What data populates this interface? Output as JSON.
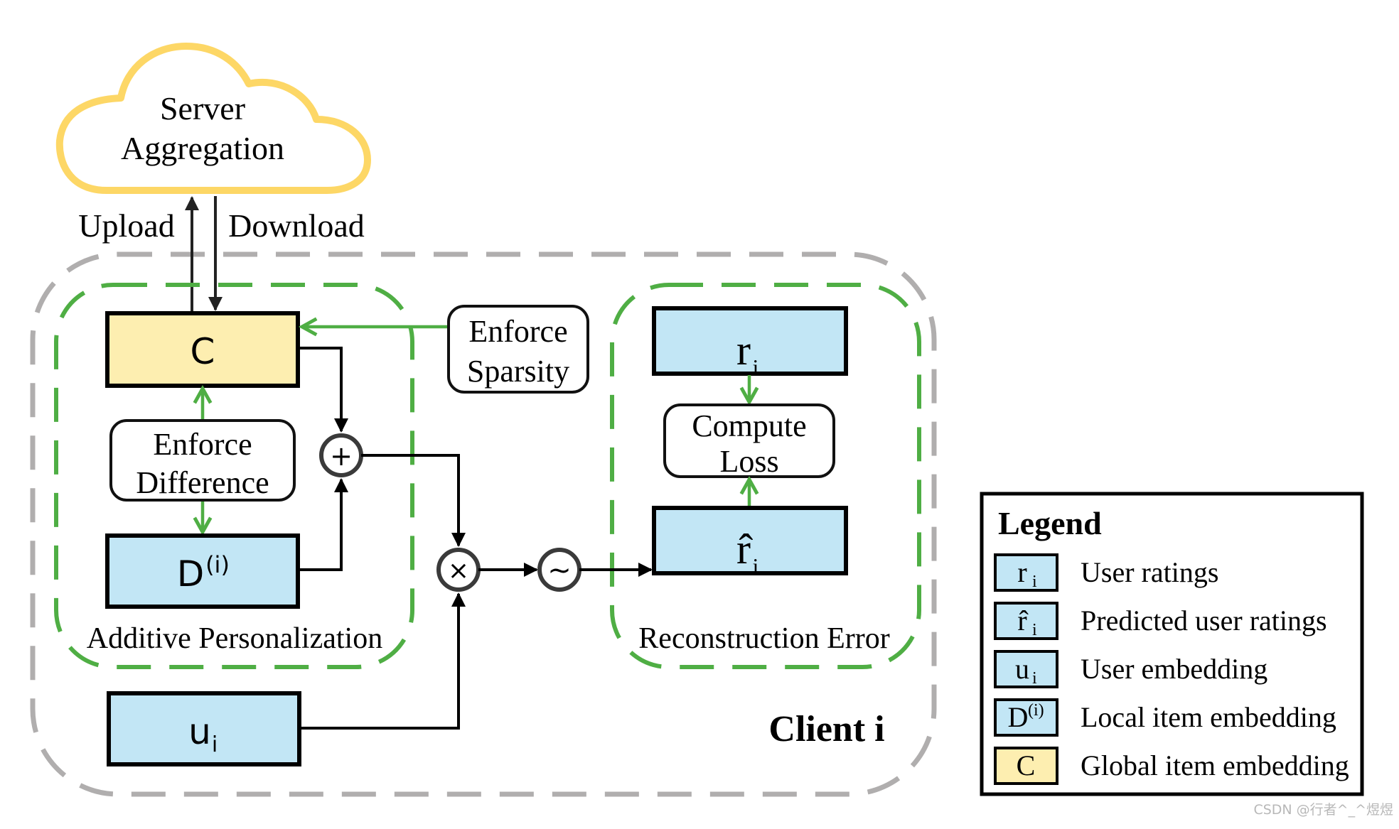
{
  "server": {
    "line1": "Server",
    "line2": "Aggregation"
  },
  "arrows": {
    "upload": "Upload",
    "download": "Download"
  },
  "client": {
    "label": "Client i",
    "additive_group_label": "Additive Personalization",
    "reconstruction_group_label": "Reconstruction Error",
    "boxes": {
      "global": {
        "symbol": "C"
      },
      "local": {
        "symbol": "D",
        "superscript": "(i)"
      },
      "user_embedding": {
        "symbol": "u",
        "subscript": "i"
      },
      "ratings": {
        "symbol": "r",
        "subscript": "i"
      },
      "predicted": {
        "symbol": "r̂",
        "subscript": "i"
      }
    },
    "processes": {
      "enforce_difference": {
        "line1": "Enforce",
        "line2": "Difference"
      },
      "enforce_sparsity": {
        "line1": "Enforce",
        "line2": "Sparsity"
      },
      "compute_loss": {
        "line1": "Compute",
        "line2": "Loss"
      }
    },
    "operators": {
      "add": "+",
      "multiply": "×",
      "activation": "~"
    }
  },
  "legend": {
    "title": "Legend",
    "items": [
      {
        "symbol": "r",
        "sub": "i",
        "sup": "",
        "color": "#c2e6f5",
        "label": "User ratings"
      },
      {
        "symbol": "r̂",
        "sub": "i",
        "sup": "",
        "color": "#c2e6f5",
        "label": "Predicted user ratings"
      },
      {
        "symbol": "u",
        "sub": "i",
        "sup": "",
        "color": "#c2e6f5",
        "label": "User embedding"
      },
      {
        "symbol": "D",
        "sub": "",
        "sup": "(i)",
        "color": "#c2e6f5",
        "label": "Local item embedding"
      },
      {
        "symbol": "C",
        "sub": "",
        "sup": "",
        "color": "#fdeeb0",
        "label": "Global item embedding"
      }
    ]
  },
  "colors": {
    "embedding_blue": "#c2e6f5",
    "global_yellow": "#fdeeb0",
    "cloud_yellow": "#fdd766",
    "group_green": "#4fae44",
    "client_grey": "#b0aeae"
  },
  "watermark": "CSDN @行者^_^煜煜"
}
